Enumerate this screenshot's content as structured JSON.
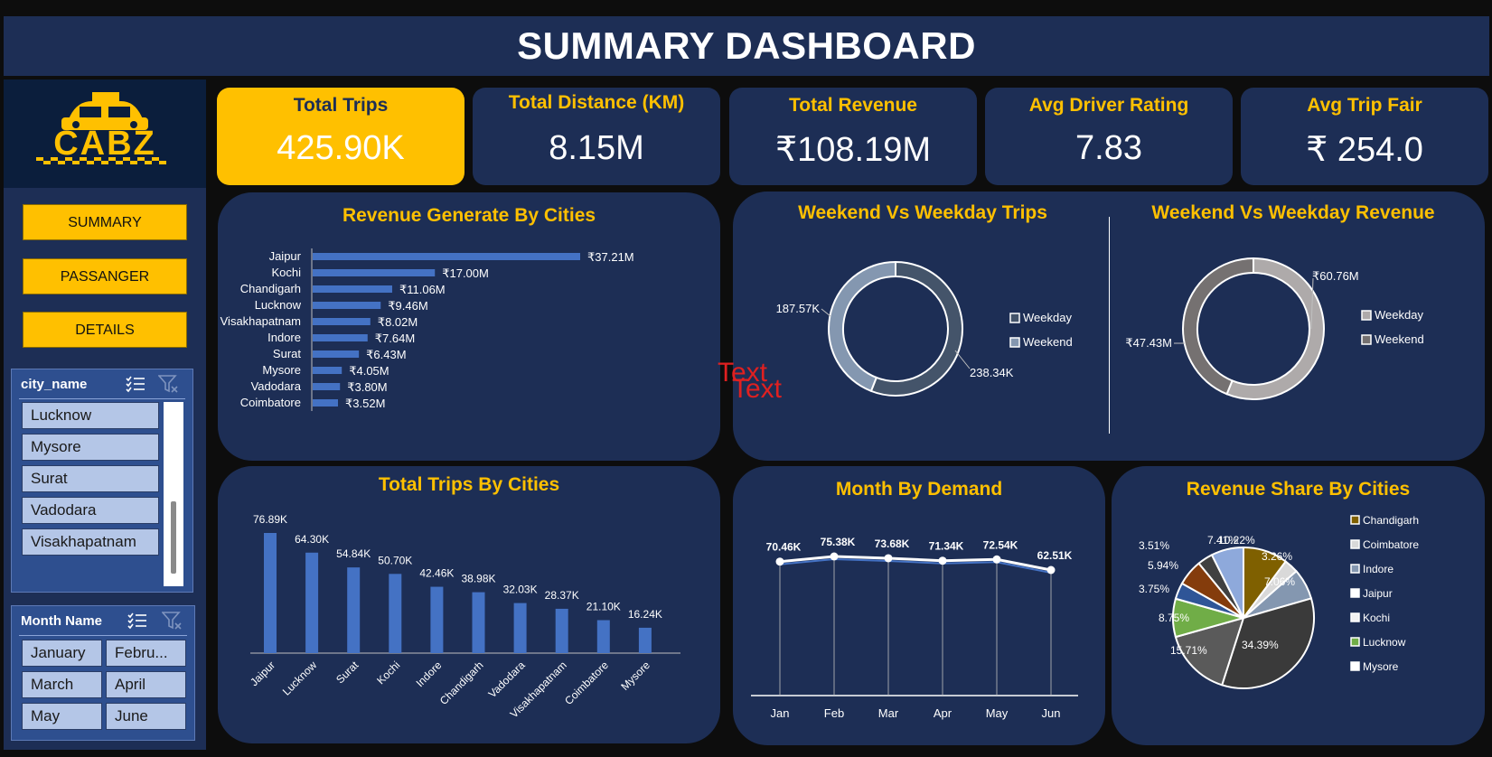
{
  "title": "SUMMARY DASHBOARD",
  "logo": {
    "text": "CABZ"
  },
  "nav": {
    "summary": "SUMMARY",
    "passenger": "PASSANGER",
    "details": "DETAILS"
  },
  "city_slicer": {
    "header": "city_name",
    "items": [
      "Lucknow",
      "Mysore",
      "Surat",
      "Vadodara",
      "Visakhapatnam"
    ]
  },
  "month_slicer": {
    "header": "Month Name",
    "items": [
      "January",
      "Febru...",
      "March",
      "April",
      "May",
      "June"
    ]
  },
  "kpis": [
    {
      "label": "Total Trips",
      "value": "425.90K"
    },
    {
      "label": "Total Distance (KM)",
      "value": "8.15M"
    },
    {
      "label": "Total Revenue",
      "value": "₹108.19M"
    },
    {
      "label": "Avg Driver Rating",
      "value": "7.83"
    },
    {
      "label": "Avg Trip Fair",
      "value": "₹ 254.0"
    }
  ],
  "panels": {
    "revenue_by_city": "Revenue Generate By Cities",
    "weekend_trips": "Weekend Vs Weekday Trips",
    "weekend_revenue": "Weekend Vs Weekday Revenue",
    "trips_by_city": "Total Trips By Cities",
    "month_demand": "Month By Demand",
    "revenue_share": "Revenue Share By Cities"
  },
  "stray_text": [
    "Text",
    "Text"
  ],
  "colors": {
    "accent": "#ffc000",
    "panel": "#1d2e55",
    "bar": "#4472c4",
    "white": "#ffffff"
  },
  "chart_data": [
    {
      "id": "revenue_by_city",
      "type": "bar",
      "orientation": "horizontal",
      "categories": [
        "Jaipur",
        "Kochi",
        "Chandigarh",
        "Lucknow",
        "Visakhapatnam",
        "Indore",
        "Surat",
        "Mysore",
        "Vadodara",
        "Coimbatore"
      ],
      "values": [
        37.21,
        17.0,
        11.06,
        9.46,
        8.02,
        7.64,
        6.43,
        4.05,
        3.8,
        3.52
      ],
      "labels": [
        "₹37.21M",
        "₹17.00M",
        "₹11.06M",
        "₹9.46M",
        "₹8.02M",
        "₹7.64M",
        "₹6.43M",
        "₹4.05M",
        "₹3.80M",
        "₹3.52M"
      ]
    },
    {
      "id": "weekend_trips",
      "type": "pie",
      "donut": true,
      "categories": [
        "Weekday",
        "Weekend"
      ],
      "values": [
        238.34,
        187.57
      ],
      "labels": [
        "238.34K",
        "187.57K"
      ],
      "colors": [
        "#44546a",
        "#8497b0"
      ],
      "legend": "right"
    },
    {
      "id": "weekend_revenue",
      "type": "pie",
      "donut": true,
      "categories": [
        "Weekday",
        "Weekend"
      ],
      "values": [
        60.76,
        47.43
      ],
      "labels": [
        "₹60.76M",
        "₹47.43M"
      ],
      "colors": [
        "#aeaaaa",
        "#757171"
      ],
      "legend": "right"
    },
    {
      "id": "trips_by_city",
      "type": "bar",
      "categories": [
        "Jaipur",
        "Lucknow",
        "Surat",
        "Kochi",
        "Indore",
        "Chandigarh",
        "Vadodara",
        "Visakhapatnam",
        "Coimbatore",
        "Mysore"
      ],
      "values": [
        76.89,
        64.3,
        54.84,
        50.7,
        42.46,
        38.98,
        32.03,
        28.37,
        21.1,
        16.24
      ],
      "labels": [
        "76.89K",
        "64.30K",
        "54.84K",
        "50.70K",
        "42.46K",
        "38.98K",
        "32.03K",
        "28.37K",
        "21.10K",
        "16.24K"
      ]
    },
    {
      "id": "month_demand",
      "type": "line",
      "x": [
        "Jan",
        "Feb",
        "Mar",
        "Apr",
        "May",
        "Jun"
      ],
      "values": [
        70.46,
        75.38,
        73.68,
        71.34,
        72.54,
        62.51
      ],
      "labels": [
        "70.46K",
        "75.38K",
        "73.68K",
        "71.34K",
        "72.54K",
        "62.51K"
      ]
    },
    {
      "id": "revenue_share",
      "type": "pie",
      "slices": [
        {
          "name": "Chandigarh",
          "value": 10.22,
          "color": "#7f6000"
        },
        {
          "name": "",
          "value": 3.26,
          "color": "#d9d9d9"
        },
        {
          "name": "",
          "value": 7.06,
          "color": "#8497b0"
        },
        {
          "name": "",
          "value": 34.39,
          "color": "#3a3a3a"
        },
        {
          "name": "",
          "value": 15.71,
          "color": "#5a5a5a"
        },
        {
          "name": "",
          "value": 8.75,
          "color": "#70ad47"
        },
        {
          "name": "",
          "value": 3.75,
          "color": "#2f5597"
        },
        {
          "name": "",
          "value": 5.94,
          "color": "#843c0c"
        },
        {
          "name": "",
          "value": 3.51,
          "color": "#404040"
        },
        {
          "name": "",
          "value": 7.41,
          "color": "#8ea9db"
        }
      ],
      "labels": [
        "10.22%",
        "3.26%",
        "7.06%",
        "34.39%",
        "15.71%",
        "8.75%",
        "3.75%",
        "5.94%",
        "3.51%",
        "7.41%"
      ],
      "legend_items": [
        {
          "name": "Chandigarh",
          "color": "#7f6000"
        },
        {
          "name": "Coimbatore",
          "color": "#d9d9d9"
        },
        {
          "name": "Indore",
          "color": "#8497b0"
        },
        {
          "name": "Jaipur",
          "color": "#ffffff"
        },
        {
          "name": "Kochi",
          "color": "#f2f2f2"
        },
        {
          "name": "Lucknow",
          "color": "#70ad47"
        },
        {
          "name": "Mysore",
          "color": "#ffffff"
        }
      ],
      "legend": "right"
    }
  ]
}
